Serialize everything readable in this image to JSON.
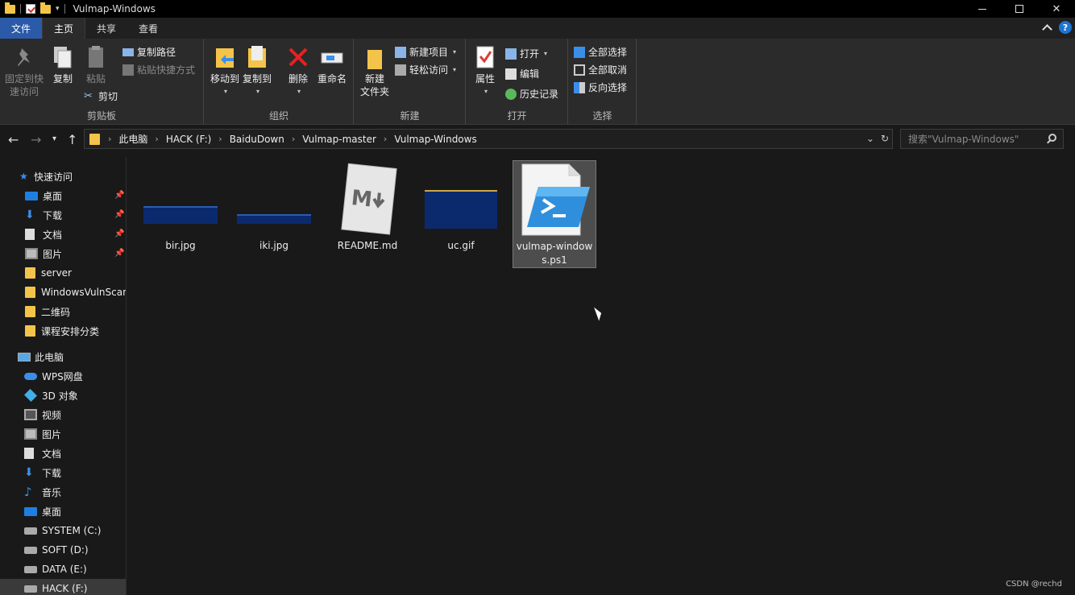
{
  "window": {
    "title": "Vulmap-Windows",
    "minimize_label": "—",
    "maximize_label": "□",
    "close_label": "✕"
  },
  "tabs": [
    {
      "label": "文件"
    },
    {
      "label": "主页"
    },
    {
      "label": "共享"
    },
    {
      "label": "查看"
    }
  ],
  "ribbon": {
    "clipboard": {
      "pin_label": "固定到快\n速访问",
      "copy_label": "复制",
      "paste_label": "粘贴",
      "copy_path_label": "复制路径",
      "paste_shortcut_label": "粘贴快捷方式",
      "cut_label": "剪切",
      "group_label": "剪贴板"
    },
    "organize": {
      "move_to_label": "移动到",
      "copy_to_label": "复制到",
      "delete_label": "删除",
      "rename_label": "重命名",
      "group_label": "组织"
    },
    "new": {
      "new_folder_label": "新建\n文件夹",
      "new_item_label": "新建项目",
      "easy_access_label": "轻松访问",
      "group_label": "新建"
    },
    "open": {
      "properties_label": "属性",
      "open_label": "打开",
      "edit_label": "编辑",
      "history_label": "历史记录",
      "group_label": "打开"
    },
    "select": {
      "select_all_label": "全部选择",
      "select_none_label": "全部取消",
      "invert_label": "反向选择",
      "group_label": "选择"
    }
  },
  "address": {
    "crumbs": [
      "此电脑",
      "HACK (F:)",
      "BaiduDown",
      "Vulmap-master",
      "Vulmap-Windows"
    ],
    "search_placeholder": "搜索\"Vulmap-Windows\""
  },
  "sidebar": {
    "quick_access": "快速访问",
    "quick_items": [
      {
        "label": "桌面",
        "icon": "desktop-icon",
        "pinned": true
      },
      {
        "label": "下载",
        "icon": "download-icon",
        "pinned": true
      },
      {
        "label": "文档",
        "icon": "documents-icon",
        "pinned": true
      },
      {
        "label": "图片",
        "icon": "pictures-icon",
        "pinned": true
      },
      {
        "label": "server",
        "icon": "folder-icon",
        "pinned": false
      },
      {
        "label": "WindowsVulnScan",
        "icon": "folder-icon",
        "pinned": false
      },
      {
        "label": "二维码",
        "icon": "folder-icon",
        "pinned": false
      },
      {
        "label": "课程安排分类",
        "icon": "folder-icon",
        "pinned": false
      }
    ],
    "this_pc": "此电脑",
    "pc_items": [
      {
        "label": "WPS网盘",
        "icon": "cloud-icon"
      },
      {
        "label": "3D 对象",
        "icon": "3d-objects-icon"
      },
      {
        "label": "视频",
        "icon": "videos-icon"
      },
      {
        "label": "图片",
        "icon": "pictures-icon"
      },
      {
        "label": "文档",
        "icon": "documents-icon"
      },
      {
        "label": "下载",
        "icon": "download-icon"
      },
      {
        "label": "音乐",
        "icon": "music-icon"
      },
      {
        "label": "桌面",
        "icon": "desktop-icon"
      },
      {
        "label": "SYSTEM (C:)",
        "icon": "drive-icon"
      },
      {
        "label": "SOFT (D:)",
        "icon": "drive-icon"
      },
      {
        "label": "DATA (E:)",
        "icon": "drive-icon"
      },
      {
        "label": "HACK (F:)",
        "icon": "drive-icon"
      }
    ]
  },
  "files": [
    {
      "name": "bir.jpg",
      "type": "image-thumb"
    },
    {
      "name": "iki.jpg",
      "type": "image-thumb"
    },
    {
      "name": "README.md",
      "type": "markdown-icon"
    },
    {
      "name": "uc.gif",
      "type": "image-thumb"
    },
    {
      "name": "vulmap-windows.ps1",
      "type": "powershell-icon",
      "selected": true
    }
  ],
  "watermark": "CSDN @rechd",
  "colors": {
    "accent": "#2b5aa8",
    "folder": "#f4c44a",
    "background": "#191919",
    "ribbon": "#2b2b2b"
  }
}
